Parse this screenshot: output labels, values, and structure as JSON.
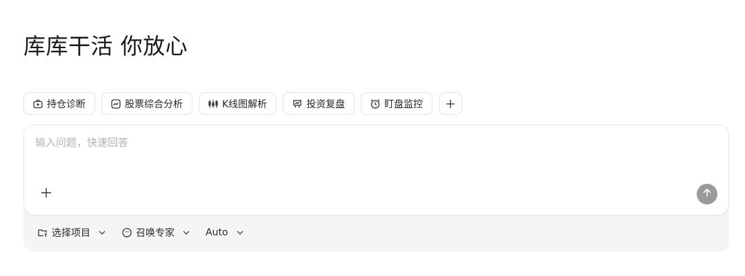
{
  "header": {
    "title": "库库干活 你放心"
  },
  "quick_actions": [
    {
      "label": "持仓诊断",
      "icon": "portfolio-icon"
    },
    {
      "label": "股票综合分析",
      "icon": "trend-chart-icon"
    },
    {
      "label": "K线图解析",
      "icon": "candlestick-icon"
    },
    {
      "label": "投资复盘",
      "icon": "review-board-icon"
    },
    {
      "label": "盯盘监控",
      "icon": "alarm-clock-icon"
    }
  ],
  "composer": {
    "placeholder": "输入问题，快速回答",
    "value": ""
  },
  "toolbar": {
    "project_label": "选择项目",
    "expert_label": "召唤专家",
    "model_label": "Auto"
  },
  "colors": {
    "send_button": "#9a9a9a",
    "toolbar_bg": "#f5f5f5",
    "chip_border": "#e3e3e3"
  }
}
